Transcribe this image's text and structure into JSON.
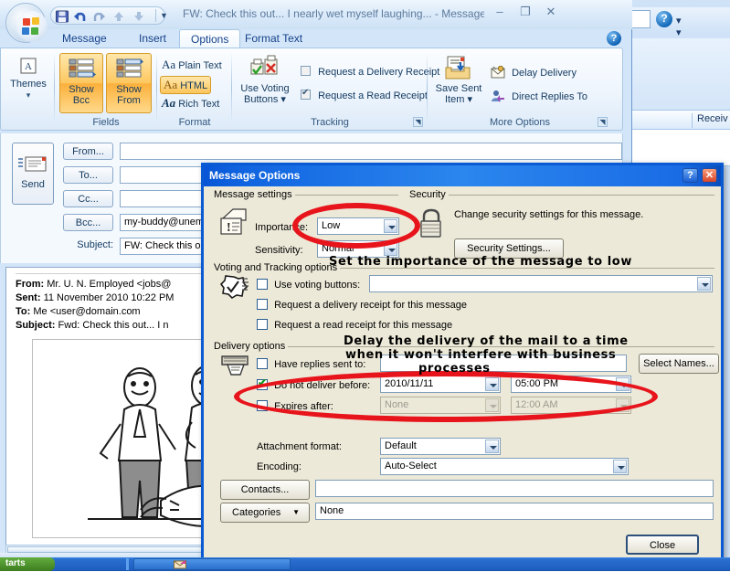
{
  "background_window": {
    "received_column": "Receiv",
    "help_icon": "?"
  },
  "message_window": {
    "title": "FW: Check this out... I nearly wet myself laughing... - Message (HT...",
    "quick_access": [
      "save-icon",
      "undo-icon",
      "redo-icon",
      "previous-icon",
      "next-icon"
    ],
    "window_buttons": {
      "minimize": "–",
      "maximize": "❐",
      "close": "✕"
    },
    "help_icon": "?",
    "tabs": [
      {
        "label": "Message",
        "active": false
      },
      {
        "label": "Insert",
        "active": false
      },
      {
        "label": "Options",
        "active": true
      },
      {
        "label": "Format Text",
        "active": false
      }
    ],
    "ribbon": {
      "themes": {
        "label": "Themes",
        "dropdown": "▾"
      },
      "fields": {
        "group_label": "Fields",
        "show_bcc": "Show\nBcc",
        "show_bcc_line1": "Show",
        "show_bcc_line2": "Bcc",
        "show_from_line1": "Show",
        "show_from_line2": "From"
      },
      "format": {
        "group_label": "Format",
        "items": [
          {
            "label": "Plain Text",
            "selected": false,
            "glyph": "Aa"
          },
          {
            "label": "HTML",
            "selected": true,
            "glyph": "Aa"
          },
          {
            "label": "Rich Text",
            "selected": false,
            "glyph": "Aa"
          }
        ]
      },
      "tracking": {
        "group_label": "Tracking",
        "use_voting_buttons_line1": "Use Voting",
        "use_voting_buttons_line2": "Buttons ▾",
        "checkboxes": [
          {
            "label": "Request a Delivery Receipt",
            "checked": false
          },
          {
            "label": "Request a Read Receipt",
            "checked": true
          }
        ]
      },
      "more_options": {
        "group_label": "More Options",
        "save_sent_item_line1": "Save Sent",
        "save_sent_item_line2": "Item ▾",
        "items": [
          "Delay Delivery",
          "Direct Replies To"
        ]
      }
    },
    "compose": {
      "send_button": "Send",
      "fields": [
        {
          "button": "From...",
          "value": ""
        },
        {
          "button": "To...",
          "value": ""
        },
        {
          "button": "Cc...",
          "value": ""
        },
        {
          "button": "Bcc...",
          "value": "my-buddy@unem"
        }
      ],
      "subject_label": "Subject:",
      "subject_value": "FW: Check this o"
    },
    "body": {
      "lines": [
        {
          "label": "From:",
          "value": "Mr. U. N. Employed <jobs@"
        },
        {
          "label": "Sent:",
          "value": "11 November 2010 10:22 PM"
        },
        {
          "label": "To:",
          "value": "Me <user@domain.com"
        },
        {
          "label": "Subject:",
          "value": "Fwd: Check this out... I n"
        }
      ]
    }
  },
  "dialog": {
    "title": "Message Options",
    "help_button": "?",
    "close_button": "✕",
    "message_settings": {
      "group_label": "Message settings",
      "importance_label": "Importance:",
      "importance_value": "Low",
      "sensitivity_label": "Sensitivity:",
      "sensitivity_value": "Normal"
    },
    "security": {
      "group_label": "Security",
      "description": "Change security settings for this message.",
      "button": "Security Settings..."
    },
    "voting_tracking": {
      "group_label": "Voting and Tracking options",
      "use_voting_buttons_label": "Use voting buttons:",
      "use_voting_buttons_checked": false,
      "use_voting_buttons_value": "",
      "delivery_receipt_label": "Request a delivery receipt for this message",
      "delivery_receipt_checked": false,
      "read_receipt_label": "Request a read receipt for this message",
      "read_receipt_checked": false
    },
    "delivery_options": {
      "group_label": "Delivery options",
      "have_replies_label": "Have replies sent to:",
      "have_replies_checked": false,
      "have_replies_value": "",
      "select_names_button": "Select Names...",
      "do_not_deliver_label": "Do not deliver before:",
      "do_not_deliver_checked": true,
      "do_not_deliver_date": "2010/11/11",
      "do_not_deliver_time": "05:00 PM",
      "expires_after_label": "Expires after:",
      "expires_after_checked": false,
      "expires_after_date": "None",
      "expires_after_time": "12:00 AM",
      "attachment_format_label": "Attachment format:",
      "attachment_format_value": "Default",
      "encoding_label": "Encoding:",
      "encoding_value": "Auto-Select"
    },
    "footer": {
      "contacts_button": "Contacts...",
      "contacts_value": "",
      "categories_button": "Categories",
      "categories_dropdown": "▼",
      "categories_value": "None",
      "close_button": "Close"
    }
  },
  "annotations": {
    "accent_color": "#e8141c",
    "note_importance": "Set the importance of the message to low",
    "note_delay_line1": "Delay the delivery of the mail to a time",
    "note_delay_line2": "when it won't interfere with business",
    "note_delay_line3": "processes"
  },
  "taskbar": {
    "start_label": "tarts"
  }
}
